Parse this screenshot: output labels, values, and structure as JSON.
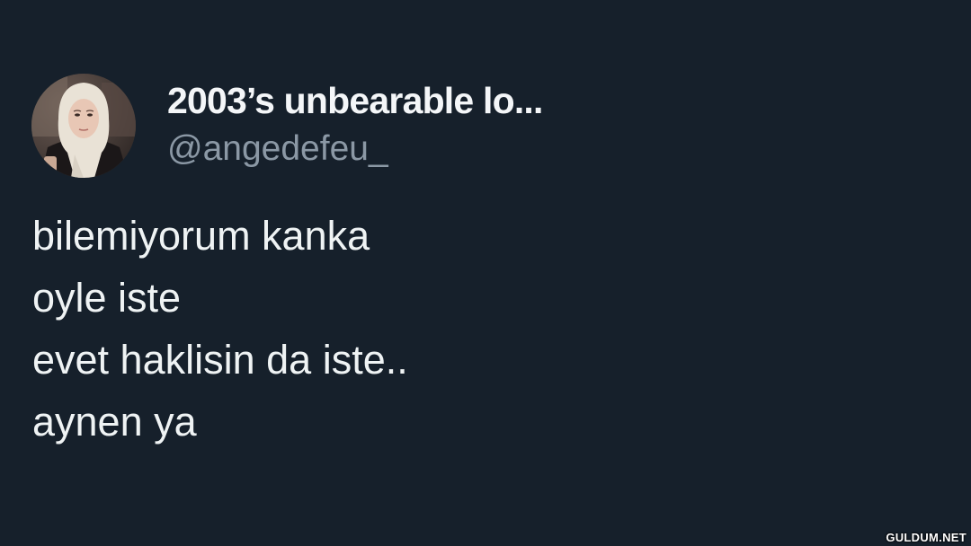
{
  "tweet": {
    "avatar_icon": "profile-photo",
    "display_name": "2003’s unbearable lo...",
    "handle": "@angedefeu_",
    "lines": [
      "bilemiyorum kanka",
      "oyle iste",
      "evet haklisin da iste..",
      "aynen ya"
    ]
  },
  "watermark": "GULDUM.NET",
  "colors": {
    "background": "#16202b",
    "name": "#f4f6f8",
    "handle": "#8b98a5",
    "text": "#eff3f4"
  }
}
